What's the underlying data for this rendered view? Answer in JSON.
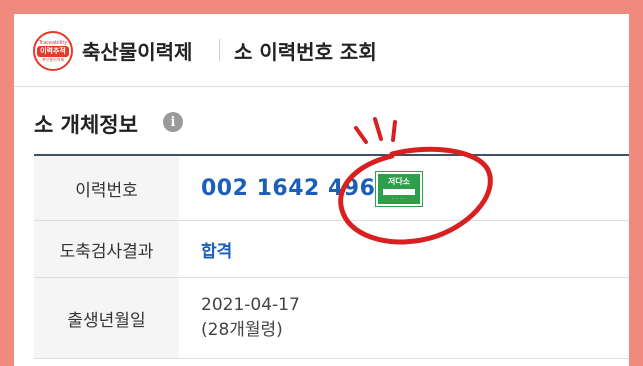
{
  "header": {
    "logo_top": "Traceability",
    "logo_mid": "이력추적",
    "logo_bottom": "축산물이력제",
    "app_name": "축산물이력제",
    "page_title": "소 이력번호 조회"
  },
  "section": {
    "title": "소 개체정보",
    "info_icon": "info-icon"
  },
  "rows": [
    {
      "label": "이력번호",
      "value": "002 1642 4967 4"
    },
    {
      "label": "도축검사결과",
      "value": "합격"
    },
    {
      "label": "출생년월일",
      "value": "2021-04-17",
      "value2": "(28개월령)"
    }
  ],
  "badge": {
    "text": "저다소",
    "icon": "low-carbon-certification-badge"
  },
  "colors": {
    "frame": "#f08a7e",
    "accent_blue": "#1b5fb8",
    "annotation_red": "#d92020",
    "badge_green": "#2f9e4a",
    "table_header_line": "#3d5169"
  }
}
